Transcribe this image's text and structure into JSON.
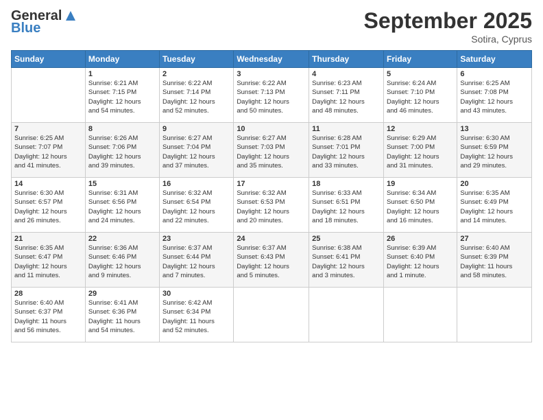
{
  "logo": {
    "general": "General",
    "blue": "Blue"
  },
  "title": "September 2025",
  "location": "Sotira, Cyprus",
  "days_of_week": [
    "Sunday",
    "Monday",
    "Tuesday",
    "Wednesday",
    "Thursday",
    "Friday",
    "Saturday"
  ],
  "weeks": [
    [
      {
        "day": "",
        "info": ""
      },
      {
        "day": "1",
        "info": "Sunrise: 6:21 AM\nSunset: 7:15 PM\nDaylight: 12 hours\nand 54 minutes."
      },
      {
        "day": "2",
        "info": "Sunrise: 6:22 AM\nSunset: 7:14 PM\nDaylight: 12 hours\nand 52 minutes."
      },
      {
        "day": "3",
        "info": "Sunrise: 6:22 AM\nSunset: 7:13 PM\nDaylight: 12 hours\nand 50 minutes."
      },
      {
        "day": "4",
        "info": "Sunrise: 6:23 AM\nSunset: 7:11 PM\nDaylight: 12 hours\nand 48 minutes."
      },
      {
        "day": "5",
        "info": "Sunrise: 6:24 AM\nSunset: 7:10 PM\nDaylight: 12 hours\nand 46 minutes."
      },
      {
        "day": "6",
        "info": "Sunrise: 6:25 AM\nSunset: 7:08 PM\nDaylight: 12 hours\nand 43 minutes."
      }
    ],
    [
      {
        "day": "7",
        "info": "Sunrise: 6:25 AM\nSunset: 7:07 PM\nDaylight: 12 hours\nand 41 minutes."
      },
      {
        "day": "8",
        "info": "Sunrise: 6:26 AM\nSunset: 7:06 PM\nDaylight: 12 hours\nand 39 minutes."
      },
      {
        "day": "9",
        "info": "Sunrise: 6:27 AM\nSunset: 7:04 PM\nDaylight: 12 hours\nand 37 minutes."
      },
      {
        "day": "10",
        "info": "Sunrise: 6:27 AM\nSunset: 7:03 PM\nDaylight: 12 hours\nand 35 minutes."
      },
      {
        "day": "11",
        "info": "Sunrise: 6:28 AM\nSunset: 7:01 PM\nDaylight: 12 hours\nand 33 minutes."
      },
      {
        "day": "12",
        "info": "Sunrise: 6:29 AM\nSunset: 7:00 PM\nDaylight: 12 hours\nand 31 minutes."
      },
      {
        "day": "13",
        "info": "Sunrise: 6:30 AM\nSunset: 6:59 PM\nDaylight: 12 hours\nand 29 minutes."
      }
    ],
    [
      {
        "day": "14",
        "info": "Sunrise: 6:30 AM\nSunset: 6:57 PM\nDaylight: 12 hours\nand 26 minutes."
      },
      {
        "day": "15",
        "info": "Sunrise: 6:31 AM\nSunset: 6:56 PM\nDaylight: 12 hours\nand 24 minutes."
      },
      {
        "day": "16",
        "info": "Sunrise: 6:32 AM\nSunset: 6:54 PM\nDaylight: 12 hours\nand 22 minutes."
      },
      {
        "day": "17",
        "info": "Sunrise: 6:32 AM\nSunset: 6:53 PM\nDaylight: 12 hours\nand 20 minutes."
      },
      {
        "day": "18",
        "info": "Sunrise: 6:33 AM\nSunset: 6:51 PM\nDaylight: 12 hours\nand 18 minutes."
      },
      {
        "day": "19",
        "info": "Sunrise: 6:34 AM\nSunset: 6:50 PM\nDaylight: 12 hours\nand 16 minutes."
      },
      {
        "day": "20",
        "info": "Sunrise: 6:35 AM\nSunset: 6:49 PM\nDaylight: 12 hours\nand 14 minutes."
      }
    ],
    [
      {
        "day": "21",
        "info": "Sunrise: 6:35 AM\nSunset: 6:47 PM\nDaylight: 12 hours\nand 11 minutes."
      },
      {
        "day": "22",
        "info": "Sunrise: 6:36 AM\nSunset: 6:46 PM\nDaylight: 12 hours\nand 9 minutes."
      },
      {
        "day": "23",
        "info": "Sunrise: 6:37 AM\nSunset: 6:44 PM\nDaylight: 12 hours\nand 7 minutes."
      },
      {
        "day": "24",
        "info": "Sunrise: 6:37 AM\nSunset: 6:43 PM\nDaylight: 12 hours\nand 5 minutes."
      },
      {
        "day": "25",
        "info": "Sunrise: 6:38 AM\nSunset: 6:41 PM\nDaylight: 12 hours\nand 3 minutes."
      },
      {
        "day": "26",
        "info": "Sunrise: 6:39 AM\nSunset: 6:40 PM\nDaylight: 12 hours\nand 1 minute."
      },
      {
        "day": "27",
        "info": "Sunrise: 6:40 AM\nSunset: 6:39 PM\nDaylight: 11 hours\nand 58 minutes."
      }
    ],
    [
      {
        "day": "28",
        "info": "Sunrise: 6:40 AM\nSunset: 6:37 PM\nDaylight: 11 hours\nand 56 minutes."
      },
      {
        "day": "29",
        "info": "Sunrise: 6:41 AM\nSunset: 6:36 PM\nDaylight: 11 hours\nand 54 minutes."
      },
      {
        "day": "30",
        "info": "Sunrise: 6:42 AM\nSunset: 6:34 PM\nDaylight: 11 hours\nand 52 minutes."
      },
      {
        "day": "",
        "info": ""
      },
      {
        "day": "",
        "info": ""
      },
      {
        "day": "",
        "info": ""
      },
      {
        "day": "",
        "info": ""
      }
    ]
  ]
}
